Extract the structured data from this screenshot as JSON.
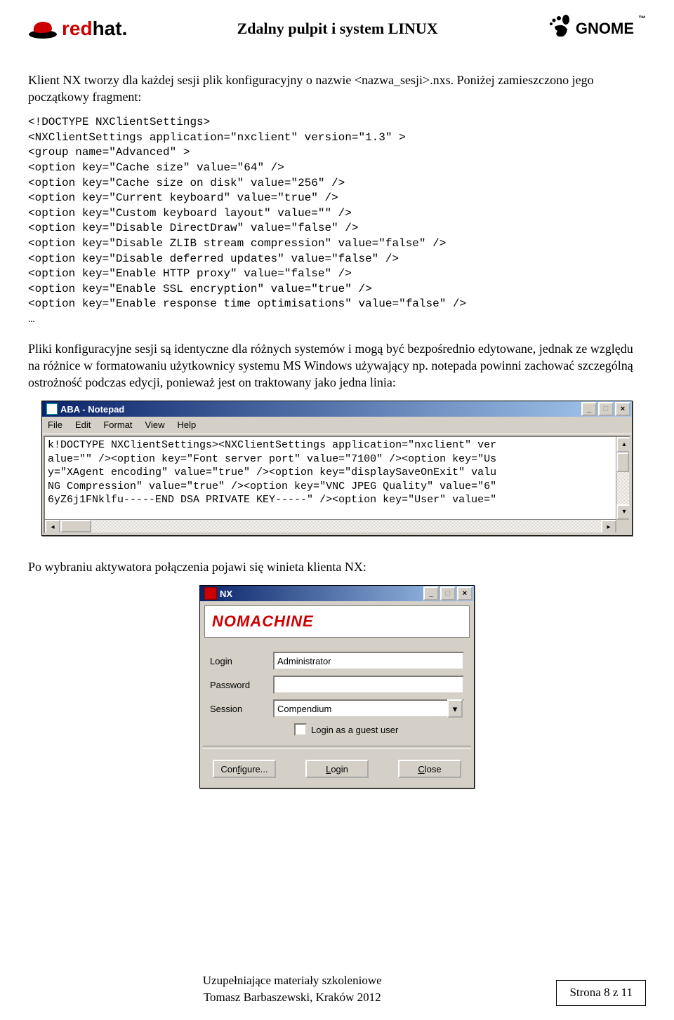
{
  "header": {
    "title": "Zdalny pulpit i system LINUX",
    "redhat_label": "redhat.",
    "gnome_label": "GNOME",
    "gnome_tm": "™"
  },
  "para1": "Klient NX tworzy dla każdej sesji plik konfiguracyjny o nazwie <nazwa_sesji>.nxs. Poniżej zamieszczono jego początkowy fragment:",
  "code_block": "<!DOCTYPE NXClientSettings>\n<NXClientSettings application=\"nxclient\" version=\"1.3\" >\n<group name=\"Advanced\" >\n<option key=\"Cache size\" value=\"64\" />\n<option key=\"Cache size on disk\" value=\"256\" />\n<option key=\"Current keyboard\" value=\"true\" />\n<option key=\"Custom keyboard layout\" value=\"\" />\n<option key=\"Disable DirectDraw\" value=\"false\" />\n<option key=\"Disable ZLIB stream compression\" value=\"false\" />\n<option key=\"Disable deferred updates\" value=\"false\" />\n<option key=\"Enable HTTP proxy\" value=\"false\" />\n<option key=\"Enable SSL encryption\" value=\"true\" />\n<option key=\"Enable response time optimisations\" value=\"false\" />\n…",
  "para2": "Pliki konfiguracyjne sesji są identyczne dla różnych systemów i mogą być bezpośrednio edytowane, jednak ze względu na różnice w formatowaniu użytkownicy systemu MS Windows używający np. notepada powinni zachować szczególną ostrożność podczas edycji, ponieważ jest on traktowany jako jedna linia:",
  "notepad": {
    "title": "ABA - Notepad",
    "menu": [
      "File",
      "Edit",
      "Format",
      "View",
      "Help"
    ],
    "content": "k!DOCTYPE NXClientSettings><NXClientSettings application=\"nxclient\" ver\nalue=\"\" /><option key=\"Font server port\" value=\"7100\" /><option key=\"Us\ny=\"XAgent encoding\" value=\"true\" /><option key=\"displaySaveOnExit\" valu\nNG Compression\" value=\"true\" /><option key=\"VNC JPEG Quality\" value=\"6\"\n6yZ6j1FNklfu-----END DSA PRIVATE KEY-----\" /><option key=\"User\" value=\""
  },
  "para3": "Po wybraniu aktywatora połączenia pojawi się winieta klienta NX:",
  "nx": {
    "title": "NX",
    "brand": "NOMACHINE",
    "login_label": "Login",
    "login_value": "Administrator",
    "password_label": "Password",
    "password_value": "",
    "session_label": "Session",
    "session_value": "Compendium",
    "guest_label": "Login as a guest user",
    "buttons": {
      "configure": "Configure...",
      "login": "Login",
      "close": "Close"
    }
  },
  "footer": {
    "line1": "Uzupełniające materiały szkoleniowe",
    "line2": "Tomasz Barbaszewski, Kraków 2012",
    "page": "Strona 8 z 11"
  }
}
